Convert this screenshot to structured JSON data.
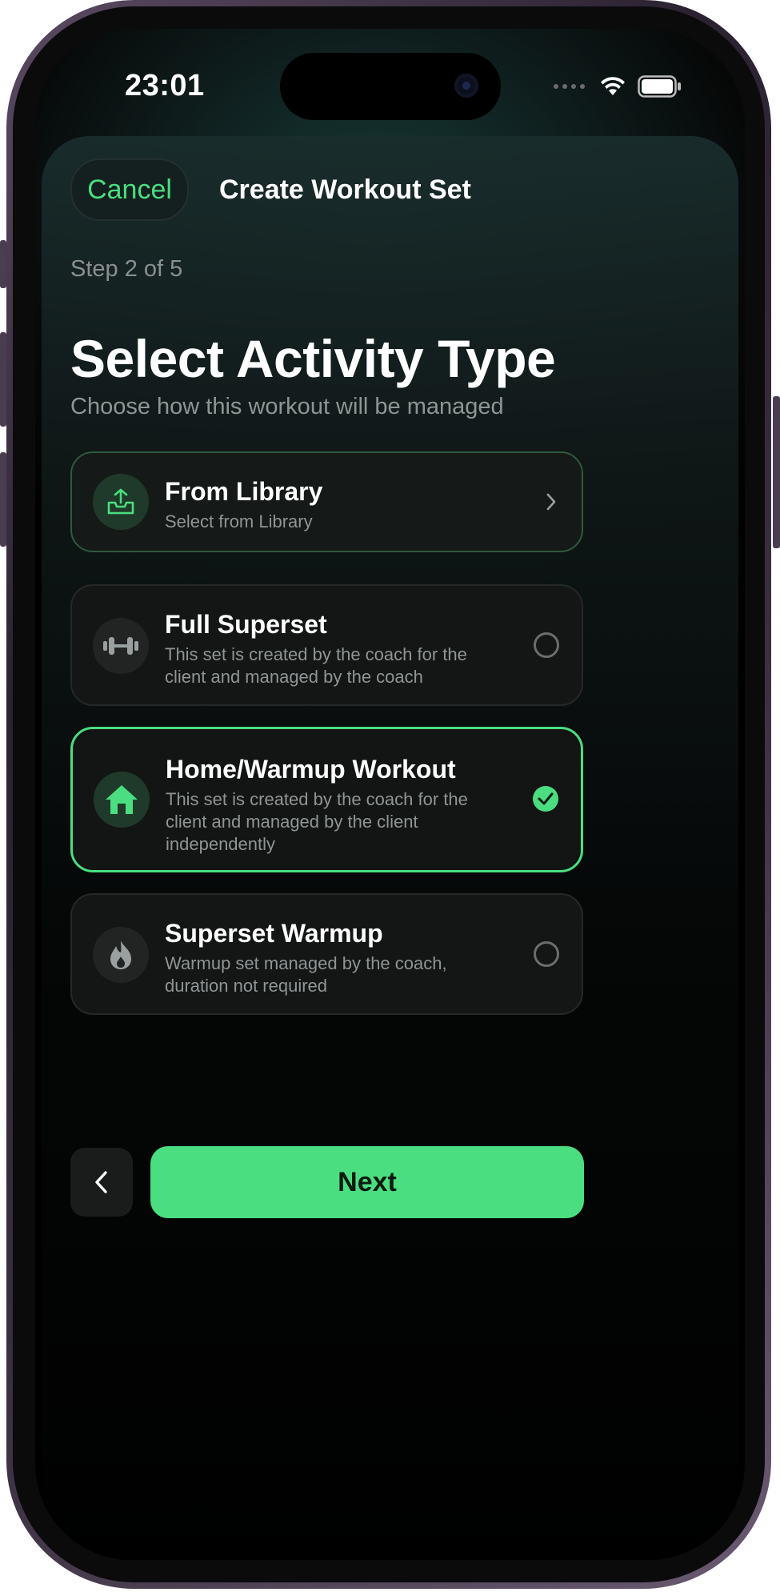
{
  "status_bar": {
    "time": "23:01"
  },
  "header": {
    "cancel_label": "Cancel",
    "title": "Create Workout Set"
  },
  "step": "Step 2 of 5",
  "heading": "Select Activity Type",
  "subheading": "Choose how this workout will be managed",
  "options": [
    {
      "title": "From Library",
      "description": "Select from Library",
      "icon": "inbox-upload-icon",
      "control": "chevron"
    },
    {
      "title": "Full Superset",
      "description": "This set is created by the coach for the client and managed by the coach",
      "icon": "dumbbell-icon",
      "control": "radio",
      "selected": false
    },
    {
      "title": "Home/Warmup Workout",
      "description": "This set is created by the coach for the client and managed by the client independently",
      "icon": "home-icon",
      "control": "radio",
      "selected": true
    },
    {
      "title": "Superset Warmup",
      "description": "Warmup set managed by the coach, duration not required",
      "icon": "flame-icon",
      "control": "radio",
      "selected": false
    }
  ],
  "footer": {
    "next_label": "Next"
  },
  "colors": {
    "accent": "#4ade80",
    "background": "#000000",
    "card": "#141515"
  }
}
